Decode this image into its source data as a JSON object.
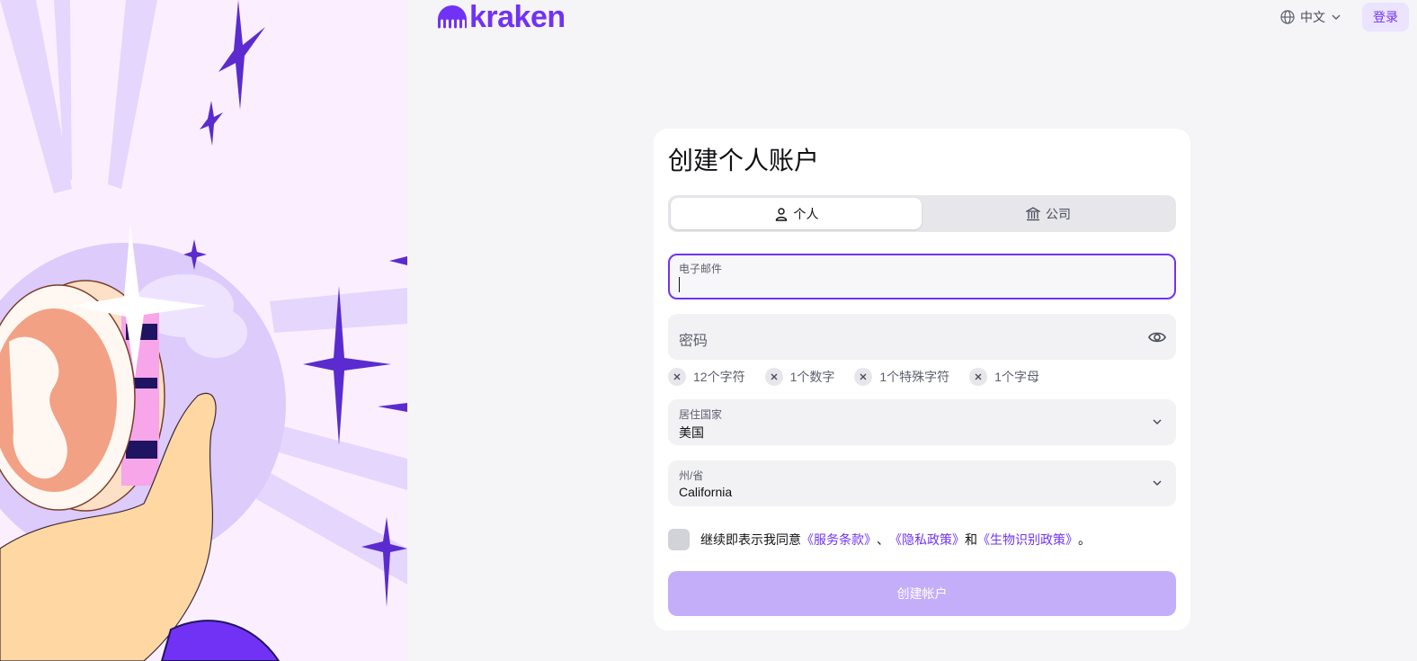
{
  "header": {
    "logo_text": "kraken",
    "language": "中文",
    "login_label": "登录"
  },
  "form": {
    "title": "创建个人账户",
    "tabs": [
      {
        "label": "个人",
        "icon": "person-icon",
        "active": true
      },
      {
        "label": "公司",
        "icon": "bank-icon",
        "active": false
      }
    ],
    "email": {
      "label": "电子邮件",
      "value": ""
    },
    "password": {
      "placeholder": "密码"
    },
    "requirements": [
      {
        "label": "12个字符"
      },
      {
        "label": "1个数字"
      },
      {
        "label": "1个特殊字符"
      },
      {
        "label": "1个字母"
      }
    ],
    "country": {
      "label": "居住国家",
      "value": "美国"
    },
    "state": {
      "label": "州/省",
      "value": "California"
    },
    "agreement": {
      "prefix": "继续即表示我同意",
      "terms": "《服务条款》",
      "sep1": "、",
      "privacy": "《隐私政策》",
      "sep2": "和",
      "biometric": "《生物识别政策》",
      "suffix": "。"
    },
    "submit_label": "创建帐户"
  },
  "colors": {
    "brand": "#7132f5",
    "submit_disabled": "#c4aef9",
    "illustration_bg": "#fbefff"
  }
}
